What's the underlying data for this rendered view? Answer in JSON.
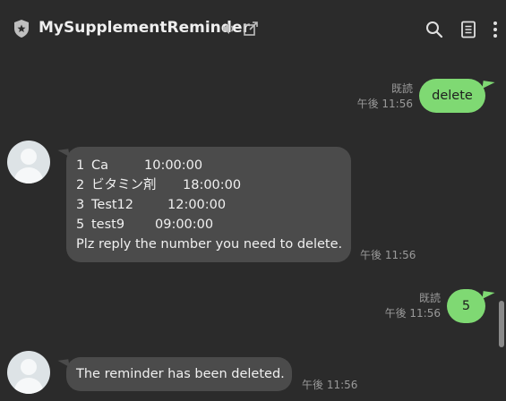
{
  "header": {
    "title": "MySupplementReminder",
    "icons": [
      "official-badge-icon",
      "speaker-icon",
      "external-window-icon",
      "search-icon",
      "notes-icon",
      "more-vertical-icon"
    ]
  },
  "colors": {
    "background": "#2b2b2b",
    "incoming_bubble": "#4b4b4b",
    "outgoing_bubble": "#7fd973",
    "meta_text": "#9a9a9a"
  },
  "messages": {
    "out1": {
      "text": "delete",
      "read": "既読",
      "time": "午後 11:56"
    },
    "in1": {
      "lines": [
        {
          "num": "1",
          "name": "Ca",
          "time": "10:00:00"
        },
        {
          "num": "2",
          "name": "ビタミン剤",
          "time": "18:00:00"
        },
        {
          "num": "3",
          "name": "Test12",
          "time": "12:00:00"
        },
        {
          "num": "5",
          "name": "test9",
          "time": "09:00:00"
        }
      ],
      "prompt": "Plz reply the number you need to delete.",
      "time": "午後 11:56"
    },
    "out2": {
      "text": "5",
      "read": "既読",
      "time": "午後 11:56"
    },
    "in2": {
      "text": "The reminder has been deleted.",
      "time": "午後 11:56"
    }
  }
}
